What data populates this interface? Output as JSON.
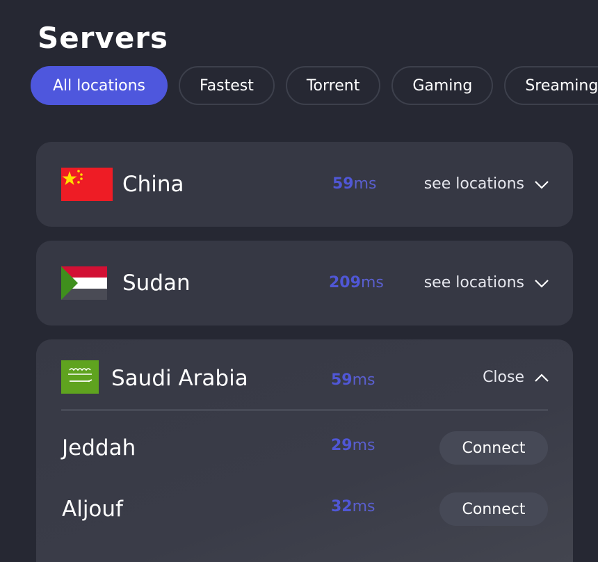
{
  "header": {
    "title": "Servers"
  },
  "filters": [
    {
      "label": "All locations",
      "active": true
    },
    {
      "label": "Fastest",
      "active": false
    },
    {
      "label": "Torrent",
      "active": false
    },
    {
      "label": "Gaming",
      "active": false
    },
    {
      "label": "Sreaming",
      "active": false
    }
  ],
  "colors": {
    "background": "#262833",
    "card": "#363844",
    "accent": "#4e57dd",
    "ping": "#5057d6"
  },
  "servers": [
    {
      "country": "China",
      "flag_icon": "china-flag-icon",
      "ping_value": "59",
      "ping_unit": "ms",
      "action_label": "see locations",
      "action_icon": "chevron-down-icon",
      "expanded": false
    },
    {
      "country": "Sudan",
      "flag_icon": "sudan-flag-icon",
      "ping_value": "209",
      "ping_unit": "ms",
      "action_label": "see locations",
      "action_icon": "chevron-down-icon",
      "expanded": false
    },
    {
      "country": "Saudi Arabia",
      "flag_icon": "saudi-arabia-flag-icon",
      "ping_value": "59",
      "ping_unit": "ms",
      "action_label": "Close",
      "action_icon": "chevron-up-icon",
      "expanded": true,
      "cities": [
        {
          "name": "Jeddah",
          "ping_value": "29",
          "ping_unit": "ms",
          "button_label": "Connect"
        },
        {
          "name": "Aljouf",
          "ping_value": "32",
          "ping_unit": "ms",
          "button_label": "Connect"
        }
      ]
    }
  ]
}
